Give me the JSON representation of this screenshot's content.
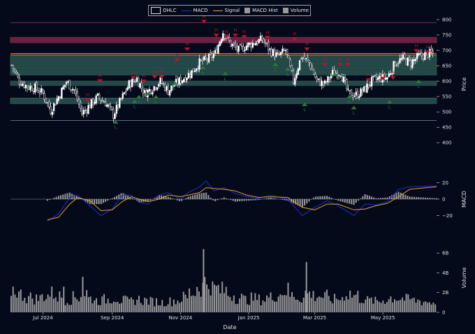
{
  "chart_data": [
    {
      "panel": "price",
      "type": "candlestick",
      "ylabel": "Price",
      "ylim": [
        380,
        800
      ],
      "yticks": [
        400,
        450,
        500,
        550,
        600,
        650,
        700,
        750,
        800
      ],
      "legend": [
        "OHLC",
        "MACD",
        "Signal",
        "MACD Hist",
        "Volume"
      ],
      "legend_placement": "top-center",
      "x_range": [
        "2024-06-02",
        "2025-06-18"
      ],
      "close_series_weekly": [
        {
          "date": "2024-06-03",
          "close": 652
        },
        {
          "date": "2024-06-10",
          "close": 600
        },
        {
          "date": "2024-06-17",
          "close": 582
        },
        {
          "date": "2024-06-24",
          "close": 578
        },
        {
          "date": "2024-07-01",
          "close": 560
        },
        {
          "date": "2024-07-08",
          "close": 505
        },
        {
          "date": "2024-07-15",
          "close": 550
        },
        {
          "date": "2024-07-22",
          "close": 598
        },
        {
          "date": "2024-07-29",
          "close": 570
        },
        {
          "date": "2024-08-05",
          "close": 495
        },
        {
          "date": "2024-08-12",
          "close": 522
        },
        {
          "date": "2024-08-19",
          "close": 548
        },
        {
          "date": "2024-08-26",
          "close": 530
        },
        {
          "date": "2024-09-02",
          "close": 490
        },
        {
          "date": "2024-09-09",
          "close": 540
        },
        {
          "date": "2024-09-16",
          "close": 590
        },
        {
          "date": "2024-09-23",
          "close": 608
        },
        {
          "date": "2024-09-30",
          "close": 560
        },
        {
          "date": "2024-10-07",
          "close": 578
        },
        {
          "date": "2024-10-14",
          "close": 600
        },
        {
          "date": "2024-10-21",
          "close": 568
        },
        {
          "date": "2024-10-28",
          "close": 592
        },
        {
          "date": "2024-11-04",
          "close": 610
        },
        {
          "date": "2024-11-11",
          "close": 630
        },
        {
          "date": "2024-11-18",
          "close": 660
        },
        {
          "date": "2024-11-25",
          "close": 670
        },
        {
          "date": "2024-12-02",
          "close": 690
        },
        {
          "date": "2024-12-09",
          "close": 760
        },
        {
          "date": "2024-12-16",
          "close": 720
        },
        {
          "date": "2024-12-23",
          "close": 700
        },
        {
          "date": "2024-12-30",
          "close": 715
        },
        {
          "date": "2025-01-06",
          "close": 725
        },
        {
          "date": "2025-01-13",
          "close": 735
        },
        {
          "date": "2025-01-20",
          "close": 700
        },
        {
          "date": "2025-01-27",
          "close": 680
        },
        {
          "date": "2025-02-03",
          "close": 700
        },
        {
          "date": "2025-02-10",
          "close": 600
        },
        {
          "date": "2025-02-17",
          "close": 680
        },
        {
          "date": "2025-02-24",
          "close": 660
        },
        {
          "date": "2025-03-03",
          "close": 600
        },
        {
          "date": "2025-03-10",
          "close": 590
        },
        {
          "date": "2025-03-17",
          "close": 625
        },
        {
          "date": "2025-03-24",
          "close": 630
        },
        {
          "date": "2025-03-31",
          "close": 560
        },
        {
          "date": "2025-04-07",
          "close": 555
        },
        {
          "date": "2025-04-14",
          "close": 570
        },
        {
          "date": "2025-04-21",
          "close": 600
        },
        {
          "date": "2025-04-28",
          "close": 610
        },
        {
          "date": "2025-05-05",
          "close": 612
        },
        {
          "date": "2025-05-12",
          "close": 660
        },
        {
          "date": "2025-05-19",
          "close": 672
        },
        {
          "date": "2025-05-26",
          "close": 660
        },
        {
          "date": "2025-06-02",
          "close": 680
        },
        {
          "date": "2025-06-09",
          "close": 688
        },
        {
          "date": "2025-06-16",
          "close": 690
        }
      ],
      "horizontal_lines": [
        {
          "value": 790,
          "color": "#7a2a4a"
        },
        {
          "value": 690,
          "color": "#d98a2b"
        },
        {
          "value": 685,
          "color": "#d98a2b"
        },
        {
          "value": 472,
          "color": "#5a6a7a"
        }
      ],
      "zones": [
        {
          "from": 725,
          "to": 742,
          "color": "#8a2a4e"
        },
        {
          "from": 663,
          "to": 683,
          "color": "#2f5e58"
        },
        {
          "from": 640,
          "to": 660,
          "color": "#2f5e58"
        },
        {
          "from": 620,
          "to": 637,
          "color": "#2f5e58"
        },
        {
          "from": 586,
          "to": 600,
          "color": "#2f5e58"
        },
        {
          "from": 527,
          "to": 545,
          "color": "#2f5e58"
        }
      ],
      "high_markers": [
        {
          "date": "2024-08-10",
          "price": 535,
          "label": "H"
        },
        {
          "date": "2024-08-21",
          "price": 597,
          "label": "H"
        },
        {
          "date": "2024-09-20",
          "price": 607,
          "label": "H"
        },
        {
          "date": "2024-09-29",
          "price": 596,
          "label": "H"
        },
        {
          "date": "2024-10-09",
          "price": 610,
          "label": "H"
        },
        {
          "date": "2024-10-15",
          "price": 610,
          "label": "H"
        },
        {
          "date": "2024-10-29",
          "price": 665,
          "label": "H"
        },
        {
          "date": "2024-11-07",
          "price": 700,
          "label": "H"
        },
        {
          "date": "2024-11-22",
          "price": 790,
          "label": "H"
        },
        {
          "date": "2024-12-03",
          "price": 745,
          "label": "H"
        },
        {
          "date": "2024-12-12",
          "price": 740,
          "label": "H"
        },
        {
          "date": "2024-12-20",
          "price": 745,
          "label": "H"
        },
        {
          "date": "2024-12-28",
          "price": 740,
          "label": "H"
        },
        {
          "date": "2025-01-18",
          "price": 738,
          "label": "H"
        },
        {
          "date": "2025-02-11",
          "price": 733,
          "label": "H"
        },
        {
          "date": "2025-02-22",
          "price": 700,
          "label": "H"
        },
        {
          "date": "2025-03-10",
          "price": 650,
          "label": "H"
        },
        {
          "date": "2025-03-24",
          "price": 650,
          "label": "H"
        },
        {
          "date": "2025-03-31",
          "price": 650,
          "label": "H"
        },
        {
          "date": "2025-04-18",
          "price": 600,
          "label": "H"
        },
        {
          "date": "2025-05-01",
          "price": 605,
          "label": "H"
        },
        {
          "date": "2025-05-10",
          "price": 607,
          "label": "H"
        },
        {
          "date": "2025-05-31",
          "price": 695,
          "label": "H"
        },
        {
          "date": "2025-06-10",
          "price": 690,
          "label": "H"
        }
      ],
      "low_markers": [
        {
          "date": "2024-09-04",
          "price": 473,
          "label": "L"
        },
        {
          "date": "2024-09-21",
          "price": 540,
          "label": "L"
        },
        {
          "date": "2024-09-25",
          "price": 555,
          "label": "L"
        },
        {
          "date": "2024-10-03",
          "price": 565,
          "label": "L"
        },
        {
          "date": "2024-10-10",
          "price": 555,
          "label": "L"
        },
        {
          "date": "2024-10-27",
          "price": 600,
          "label": "L"
        },
        {
          "date": "2024-11-21",
          "price": 650,
          "label": "L"
        },
        {
          "date": "2024-12-11",
          "price": 630,
          "label": "L"
        },
        {
          "date": "2025-01-25",
          "price": 660,
          "label": "L"
        },
        {
          "date": "2025-02-05",
          "price": 645,
          "label": "L"
        },
        {
          "date": "2025-02-20",
          "price": 530,
          "label": "L"
        },
        {
          "date": "2025-03-19",
          "price": 628,
          "label": "L"
        },
        {
          "date": "2025-04-01",
          "price": 555,
          "label": "L"
        },
        {
          "date": "2025-04-05",
          "price": 520,
          "label": "L"
        },
        {
          "date": "2025-05-07",
          "price": 538,
          "label": "L"
        },
        {
          "date": "2025-06-02",
          "price": 605,
          "label": "L"
        }
      ]
    },
    {
      "panel": "macd",
      "type": "line",
      "ylabel": "MACD",
      "ylim": [
        -28,
        28
      ],
      "yticks": [
        -20,
        0,
        20
      ],
      "series": [
        {
          "name": "MACD",
          "color": "#1830c8",
          "values": [
            {
              "date": "2024-07-05",
              "v": -27
            },
            {
              "date": "2024-07-15",
              "v": -18
            },
            {
              "date": "2024-07-25",
              "v": 2
            },
            {
              "date": "2024-08-01",
              "v": 5
            },
            {
              "date": "2024-08-12",
              "v": -8
            },
            {
              "date": "2024-08-22",
              "v": -20
            },
            {
              "date": "2024-09-01",
              "v": -12
            },
            {
              "date": "2024-09-10",
              "v": 5
            },
            {
              "date": "2024-09-18",
              "v": 5
            },
            {
              "date": "2024-09-25",
              "v": -4
            },
            {
              "date": "2024-10-03",
              "v": -6
            },
            {
              "date": "2024-10-13",
              "v": 5
            },
            {
              "date": "2024-10-21",
              "v": 8
            },
            {
              "date": "2024-11-01",
              "v": 0
            },
            {
              "date": "2024-11-08",
              "v": 8
            },
            {
              "date": "2024-11-18",
              "v": 15
            },
            {
              "date": "2024-11-24",
              "v": 22
            },
            {
              "date": "2024-12-01",
              "v": 10
            },
            {
              "date": "2024-12-10",
              "v": 14
            },
            {
              "date": "2024-12-20",
              "v": 7
            },
            {
              "date": "2024-12-30",
              "v": 3
            },
            {
              "date": "2025-01-10",
              "v": 1
            },
            {
              "date": "2025-01-20",
              "v": 5
            },
            {
              "date": "2025-02-05",
              "v": 0
            },
            {
              "date": "2025-02-18",
              "v": -20
            },
            {
              "date": "2025-03-01",
              "v": -10
            },
            {
              "date": "2025-03-12",
              "v": -2
            },
            {
              "date": "2025-03-22",
              "v": -8
            },
            {
              "date": "2025-04-05",
              "v": -20
            },
            {
              "date": "2025-04-15",
              "v": -6
            },
            {
              "date": "2025-04-25",
              "v": -7
            },
            {
              "date": "2025-05-05",
              "v": -3
            },
            {
              "date": "2025-05-15",
              "v": 12
            },
            {
              "date": "2025-05-25",
              "v": 15
            },
            {
              "date": "2025-06-18",
              "v": 16
            }
          ]
        },
        {
          "name": "Signal",
          "color": "#e0a030",
          "values": [
            {
              "date": "2024-07-05",
              "v": -25
            },
            {
              "date": "2024-07-15",
              "v": -22
            },
            {
              "date": "2024-07-25",
              "v": -6
            },
            {
              "date": "2024-08-01",
              "v": 2
            },
            {
              "date": "2024-08-12",
              "v": -2
            },
            {
              "date": "2024-08-22",
              "v": -14
            },
            {
              "date": "2024-09-01",
              "v": -13
            },
            {
              "date": "2024-09-10",
              "v": -3
            },
            {
              "date": "2024-09-18",
              "v": 3
            },
            {
              "date": "2024-09-25",
              "v": 0
            },
            {
              "date": "2024-10-03",
              "v": -3
            },
            {
              "date": "2024-10-13",
              "v": 0
            },
            {
              "date": "2024-10-21",
              "v": 5
            },
            {
              "date": "2024-11-01",
              "v": 3
            },
            {
              "date": "2024-11-08",
              "v": 5
            },
            {
              "date": "2024-11-18",
              "v": 8
            },
            {
              "date": "2024-11-24",
              "v": 14
            },
            {
              "date": "2024-12-01",
              "v": 13
            },
            {
              "date": "2024-12-10",
              "v": 12
            },
            {
              "date": "2024-12-20",
              "v": 10
            },
            {
              "date": "2024-12-30",
              "v": 5
            },
            {
              "date": "2025-01-10",
              "v": 2
            },
            {
              "date": "2025-01-20",
              "v": 3
            },
            {
              "date": "2025-02-05",
              "v": 2
            },
            {
              "date": "2025-02-18",
              "v": -10
            },
            {
              "date": "2025-03-01",
              "v": -13
            },
            {
              "date": "2025-03-12",
              "v": -6
            },
            {
              "date": "2025-03-22",
              "v": -6
            },
            {
              "date": "2025-04-05",
              "v": -13
            },
            {
              "date": "2025-04-15",
              "v": -12
            },
            {
              "date": "2025-04-25",
              "v": -8
            },
            {
              "date": "2025-05-05",
              "v": -5
            },
            {
              "date": "2025-05-15",
              "v": 3
            },
            {
              "date": "2025-05-25",
              "v": 12
            },
            {
              "date": "2025-06-18",
              "v": 15
            }
          ]
        }
      ],
      "histogram_name": "MACD Hist",
      "histogram_color": "#9a9a9a"
    },
    {
      "panel": "volume",
      "type": "bar",
      "ylabel": "Volume",
      "ylim": [
        0,
        7000000000
      ],
      "yticks": [
        0,
        2000000000,
        4000000000,
        6000000000
      ],
      "ytick_labels": [
        "0",
        "2B",
        "4B",
        "6B"
      ],
      "bar_color": "#9a9a9a",
      "weekly_volume": [
        2300000000,
        1800000000,
        1500000000,
        1400000000,
        1700000000,
        1900000000,
        1600000000,
        1300000000,
        1500000000,
        2000000000,
        1400000000,
        1200000000,
        1300000000,
        1500000000,
        1200000000,
        1100000000,
        1300000000,
        1200000000,
        1100000000,
        1000000000,
        1100000000,
        1200000000,
        1500000000,
        2000000000,
        2600000000,
        3000000000,
        2400000000,
        2200000000,
        1800000000,
        1500000000,
        1300000000,
        1400000000,
        1300000000,
        1500000000,
        1800000000,
        2200000000,
        1700000000,
        1500000000,
        1900000000,
        1700000000,
        1600000000,
        1300000000,
        1400000000,
        1900000000,
        1700000000,
        1400000000,
        1200000000,
        1100000000,
        1300000000,
        1500000000,
        1400000000,
        1300000000,
        1200000000,
        1100000000,
        1000000000
      ],
      "notable_spikes": [
        {
          "date": "2024-08-05",
          "value": 3600000000
        },
        {
          "date": "2024-11-21",
          "value": 6400000000
        },
        {
          "date": "2025-02-21",
          "value": 5100000000
        },
        {
          "date": "2024-07-19",
          "value": 2600000000
        }
      ]
    }
  ],
  "x_axis": {
    "label": "Date",
    "ticks": [
      {
        "date": "2024-07-01",
        "label": "Jul 2024"
      },
      {
        "date": "2024-09-01",
        "label": "Sep 2024"
      },
      {
        "date": "2024-11-01",
        "label": "Nov 2024"
      },
      {
        "date": "2025-01-01",
        "label": "Jan 2025"
      },
      {
        "date": "2025-03-01",
        "label": "Mar 2025"
      },
      {
        "date": "2025-05-01",
        "label": "May 2025"
      }
    ]
  },
  "legend_labels": {
    "ohlc": "OHLC",
    "macd": "MACD",
    "signal": "Signal",
    "hist": "MACD Hist",
    "volume": "Volume"
  },
  "colors": {
    "background": "#050a1a",
    "candle": "#ffffff",
    "axis_text": "#e0e0e0",
    "high_marker": "#c0102a",
    "low_marker": "#2a7a3a"
  }
}
